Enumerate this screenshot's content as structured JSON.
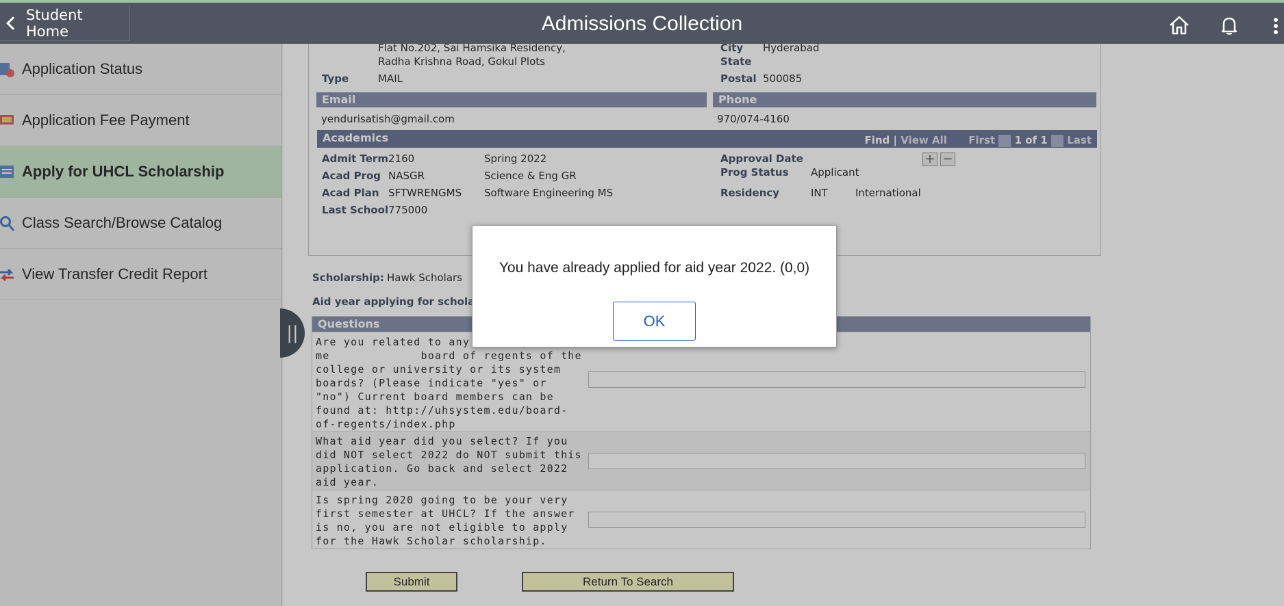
{
  "header": {
    "back_label": "Student Home",
    "title": "Admissions Collection"
  },
  "sidebar": {
    "items": [
      {
        "label": "Application Status",
        "icon": "application-status-icon"
      },
      {
        "label": "Application Fee Payment",
        "icon": "payment-icon"
      },
      {
        "label": "Apply for UHCL Scholarship",
        "icon": "form-icon",
        "active": true
      },
      {
        "label": "Class Search/Browse Catalog",
        "icon": "search-icon"
      },
      {
        "label": "View Transfer Credit Report",
        "icon": "transfer-icon"
      }
    ]
  },
  "address": {
    "line1_partial": "Flat No.202, Sai Hamsika Residency,",
    "line2": "Radha Krishna Road, Gokul Plots",
    "type_label": "Type",
    "type_value": "MAIL",
    "city_label": "City",
    "city_value": "Hyderabad",
    "state_label": "State",
    "postal_label": "Postal",
    "postal_value": "500085"
  },
  "email": {
    "header": "Email",
    "value": "yendurisatish@gmail.com"
  },
  "phone": {
    "header": "Phone",
    "value": "970/074-4160"
  },
  "academics": {
    "header": "Academics",
    "find": "Find",
    "sep": "|",
    "view_all": "View All",
    "first": "First",
    "range": "1 of 1",
    "last": "Last",
    "admit_term_label": "Admit Term",
    "admit_term_code": "2160",
    "admit_term_desc": "Spring 2022",
    "acad_prog_label": "Acad Prog",
    "acad_prog_code": "NASGR",
    "acad_prog_desc": "Science & Eng GR",
    "acad_plan_label": "Acad Plan",
    "acad_plan_code": "SFTWRENGMS",
    "acad_plan_desc": "Software Engineering MS",
    "last_school_label": "Last School",
    "last_school_code": "775000",
    "approval_date_label": "Approval Date",
    "prog_status_label": "Prog Status",
    "prog_status_value": "Applicant",
    "residency_label": "Residency",
    "residency_code": "INT",
    "residency_desc": "International",
    "add_label": "+",
    "remove_label": "−"
  },
  "scholarship": {
    "label": "Scholarship:",
    "value": "Hawk Scholars",
    "aid_year_label": "Aid year applying for schola"
  },
  "questions": {
    "header": "Questions",
    "q1": "Are you related to any me             board of regents of the college or university or its system boards?  (Please indicate \"yes\" or \"no\") Current board members can be found at: http://uhsystem.edu/board-of-regents/index.php",
    "q2": "What aid year did you select?  If you did NOT select 2022 do NOT submit this application.  Go back and select 2022 aid year.",
    "q3": "Is spring 2020 going to be your very first semester at UHCL?  If the answer is no, you are not eligible to apply for the Hawk Scholar scholarship."
  },
  "buttons": {
    "submit": "Submit",
    "return": "Return To Search"
  },
  "dialog": {
    "message": "You have already applied for aid year 2022. (0,0)",
    "ok": "OK"
  }
}
